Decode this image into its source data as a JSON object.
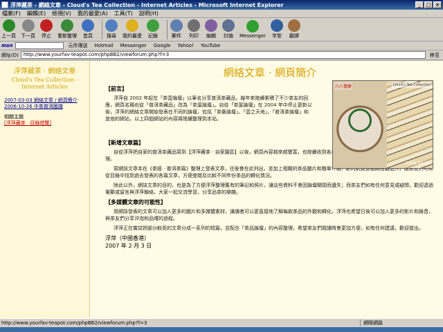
{
  "window": {
    "title": "浮萍藏茶 - 網絡文章 - Cloud's Tea Collection - Internet Articles - Microsoft Internet Explorer"
  },
  "menu": [
    "檔案(F)",
    "編輯(E)",
    "檢視(V)",
    "我的最愛(A)",
    "工具(T)",
    "說明(H)"
  ],
  "toolbar": [
    {
      "label": "上一頁",
      "icon": "back-arrow-icon",
      "color": "#2a8a2a"
    },
    {
      "label": "下一頁",
      "icon": "forward-arrow-icon",
      "color": "#888888"
    },
    {
      "label": "停止",
      "icon": "stop-icon",
      "color": "#c02020"
    },
    {
      "label": "重新整理",
      "icon": "refresh-icon",
      "color": "#3a8a3a"
    },
    {
      "label": "首頁",
      "icon": "home-icon",
      "color": "#4070c0"
    },
    {
      "label": "搜尋",
      "icon": "search-icon",
      "color": "#5080c0"
    },
    {
      "label": "我的最愛",
      "icon": "favorites-star-icon",
      "color": "#e0b020"
    },
    {
      "label": "記錄",
      "icon": "history-icon",
      "color": "#40a040"
    },
    {
      "label": "郵件",
      "icon": "mail-icon",
      "color": "#6080b0"
    },
    {
      "label": "列印",
      "icon": "print-icon",
      "color": "#707070"
    },
    {
      "label": "編輯",
      "icon": "edit-icon",
      "color": "#8060a0"
    },
    {
      "label": "討論",
      "icon": "discuss-icon",
      "color": "#607090"
    },
    {
      "label": "Messenger",
      "icon": "messenger-icon",
      "color": "#30a030"
    },
    {
      "label": "字型",
      "icon": "font-icon",
      "color": "#3060a0"
    },
    {
      "label": "翻譯",
      "icon": "translate-icon",
      "color": "#a07040"
    }
  ],
  "links": {
    "msn": "msn",
    "items": [
      "元件傳送",
      "Hotmail",
      "Messenger",
      "Google",
      "Yahoo!",
      "YouTube"
    ]
  },
  "address": {
    "label": "網址(D)",
    "value": "http://www.yourfav-teapot.com/phpBB2/viewforum.php?f=3",
    "go": "移至"
  },
  "sidebar": {
    "title": "浮萍藏茶 · 網絡文章",
    "subtitle_en": "Cloud's Tea Collection - Internet Articles",
    "nav": [
      "2007-03-03 網絡文章 / 網頁簡介",
      "2006-10-26 中茶普洱圖譜"
    ],
    "section_label": "相關主題",
    "section_link": "[浮萍藏茶 · 目錄總覽]"
  },
  "main": {
    "heading": "網絡文章 · 網頁簡介",
    "sections": [
      {
        "title": "【前言】",
        "paras": [
          "浮萍自 2002 年起在「茶壺論壇」以筆名分享普洱茶藏品，幾年來陸續累積了不少茶友的回應，網頁名稱也從「普洱茶藏品」改為「茶葉論壇」。自從「茶葉論壇」在 2004 年中停止更新以後，浮萍的網絡文章開始發表在不同的論壇，包括「茶藝論壇」、「壺之天地」、「普洱茶論壇」和其他的網站，以上四個網站的內容將陸續整理到本站。"
        ]
      },
      {
        "title": "【新增文章篇】",
        "paras": [
          "自從浮萍把自家的普洱茶藏品寫到【浮萍藏茶 · 自家園區】以後，網頁內容越來越豐富，也陸續收到各地茶友的意見和鼓勵，讓浮萍更有動力繼續整理。",
          "寫網誌文章本在《茶經 · 普洱茶篇》整理上發表文章，往後會在此列出，並加上相關的茶品圖片和簡單介紹，新的網頁連結將陸續加入，讓茶友們可以從目錄中找到過去發表的各篇文章，方便查閱及比較不同年份茶品的轉化情況。",
          "除此以外，網誌文章的目的，也是為了方便浮萍整理舊有的筆記和照片，讓這些資料不會因論壇關閉而遺失；而茶友們如有任何意見或疑問，歡迎透過電郵或留言與浮萍聯絡，大家一起交流學習，分享品茶的樂趣。"
        ]
      },
      {
        "title": "【多媒體文章的可能性】",
        "paras": [
          "用網誌發表的文章可以加入更多的圖片和多媒體素材，讓讀者可以更直接地了解每款茶品的外觀和轉化，浮萍也希望日後可以加入更多的影片和錄音，與茶友們分享沖泡和品嚐的過程。",
          "浮萍正在嘗試把部分較長的文章分成一系列的短篇，並配合「茶品論壇」的內容整理，希望茶友們閱讀時會更加方便，如有任何建議，歡迎提出。"
        ]
      }
    ],
    "signature_name": "浮萍（中國香港）",
    "signature_date": "2007 年 2 月 3 日",
    "photo": {
      "left_label": "八八青餅",
      "right_label": "Cloud's Tea Collection",
      "date": "2006-09-28"
    }
  },
  "status": {
    "text": "http://www.yourfav-teapot.com/phpBB2/viewforum.php?f=3",
    "zone": "網際網路"
  }
}
